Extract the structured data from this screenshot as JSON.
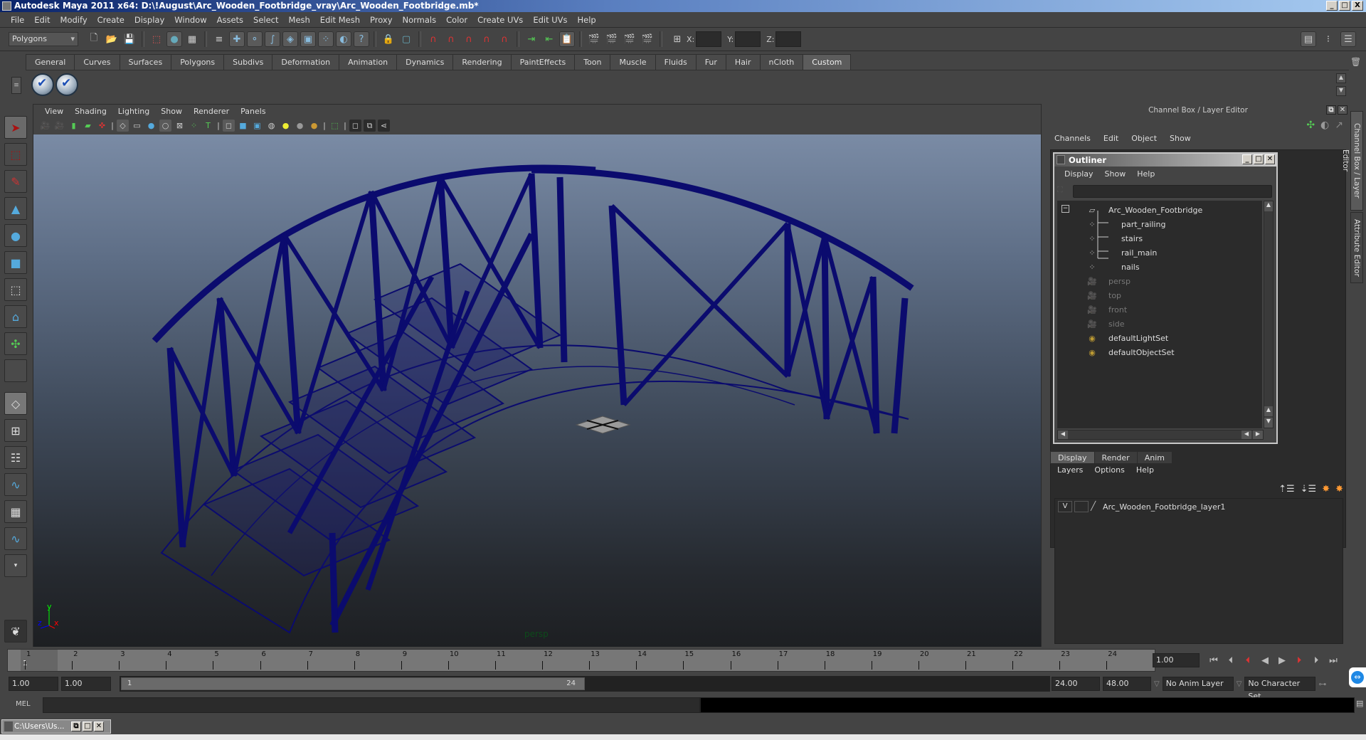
{
  "window": {
    "title": "Autodesk Maya 2011 x64: D:\\!August\\Arc_Wooden_Footbridge_vray\\Arc_Wooden_Footbridge.mb*",
    "buttons": [
      "_",
      "□",
      "X"
    ]
  },
  "menubar": [
    "File",
    "Edit",
    "Modify",
    "Create",
    "Display",
    "Window",
    "Assets",
    "Select",
    "Mesh",
    "Edit Mesh",
    "Proxy",
    "Normals",
    "Color",
    "Create UVs",
    "Edit UVs",
    "Help"
  ],
  "statusline": {
    "mode": "Polygons",
    "coord_labels": [
      "X:",
      "Y:",
      "Z:"
    ],
    "coord_values": [
      "",
      "",
      ""
    ]
  },
  "shelf": {
    "tabs": [
      "General",
      "Curves",
      "Surfaces",
      "Polygons",
      "Subdivs",
      "Deformation",
      "Animation",
      "Dynamics",
      "Rendering",
      "PaintEffects",
      "Toon",
      "Muscle",
      "Fluids",
      "Fur",
      "Hair",
      "nCloth",
      "Custom"
    ],
    "active_tab": "Custom",
    "buttons": [
      "checkmark-script-1",
      "checkmark-script-2"
    ]
  },
  "viewport": {
    "menu": [
      "View",
      "Shading",
      "Lighting",
      "Show",
      "Renderer",
      "Panels"
    ],
    "camera_label": "persp",
    "axis": {
      "x": "x",
      "y": "y",
      "z": "z"
    },
    "wire_color": "#0b0b6e"
  },
  "channelbox": {
    "header": "Channel Box / Layer Editor",
    "menu": [
      "Channels",
      "Edit",
      "Object",
      "Show"
    ]
  },
  "outliner": {
    "title": "Outliner",
    "menu": [
      "Display",
      "Show",
      "Help"
    ],
    "items": [
      {
        "label": "Arc_Wooden_Footbridge",
        "type": "group",
        "level": 0,
        "dim": false
      },
      {
        "label": "part_railing",
        "type": "mesh",
        "level": 1,
        "dim": false
      },
      {
        "label": "stairs",
        "type": "mesh",
        "level": 1,
        "dim": false
      },
      {
        "label": "rail_main",
        "type": "mesh",
        "level": 1,
        "dim": false
      },
      {
        "label": "nails",
        "type": "mesh",
        "level": 1,
        "dim": false
      },
      {
        "label": "persp",
        "type": "camera",
        "level": 0,
        "dim": true
      },
      {
        "label": "top",
        "type": "camera",
        "level": 0,
        "dim": true
      },
      {
        "label": "front",
        "type": "camera",
        "level": 0,
        "dim": true
      },
      {
        "label": "side",
        "type": "camera",
        "level": 0,
        "dim": true
      },
      {
        "label": "defaultLightSet",
        "type": "set",
        "level": 0,
        "dim": false
      },
      {
        "label": "defaultObjectSet",
        "type": "set",
        "level": 0,
        "dim": false
      }
    ]
  },
  "layereditor": {
    "tabs": [
      "Display",
      "Render",
      "Anim"
    ],
    "active_tab": "Display",
    "menu": [
      "Layers",
      "Options",
      "Help"
    ],
    "layers": [
      {
        "visible": "V",
        "name": "Arc_Wooden_Footbridge_layer1"
      }
    ]
  },
  "sidetabs": [
    "Channel Box / Layer Editor",
    "Attribute Editor"
  ],
  "timeline": {
    "ticks": [
      "1",
      "2",
      "3",
      "4",
      "5",
      "6",
      "7",
      "8",
      "9",
      "10",
      "11",
      "12",
      "13",
      "14",
      "15",
      "16",
      "17",
      "18",
      "19",
      "20",
      "21",
      "22",
      "23",
      "24"
    ],
    "current_frame": "1",
    "current_time": "1.00"
  },
  "range": {
    "start_time": "1.00",
    "playback_start": "1.00",
    "slider_start": "1",
    "slider_end": "24",
    "playback_end": "24.00",
    "end_time": "48.00",
    "anim_layer": "No Anim Layer",
    "character_set": "No Character Set"
  },
  "commandline": {
    "label": "MEL",
    "value": "",
    "result": ""
  },
  "taskbar": {
    "minimized_window": "C:\\Users\\Us..."
  }
}
